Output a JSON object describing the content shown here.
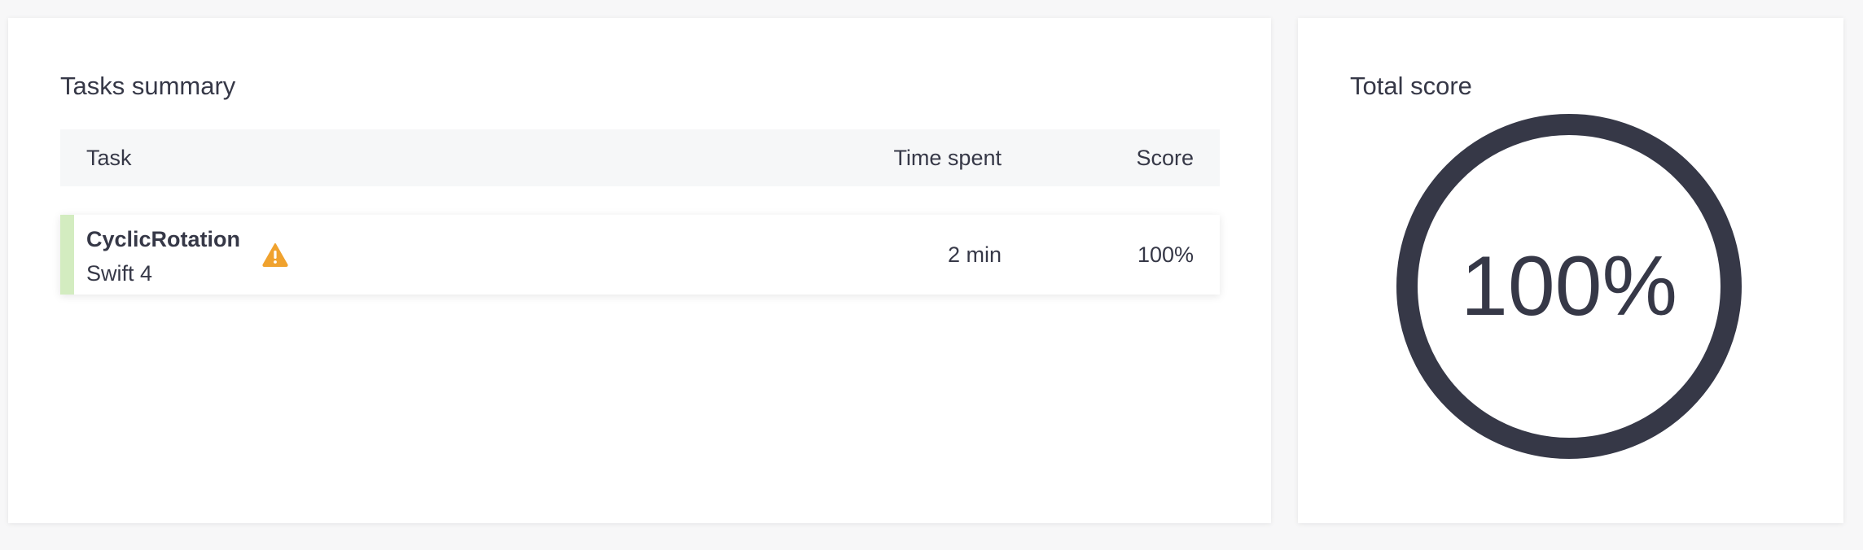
{
  "tasks_summary": {
    "title": "Tasks summary",
    "columns": {
      "task": "Task",
      "time_spent": "Time spent",
      "score": "Score"
    },
    "rows": [
      {
        "name": "CyclicRotation",
        "language": "Swift 4",
        "time_spent": "2 min",
        "score": "100%",
        "icon": "warning-icon",
        "accent_color": "#d3ecc0"
      }
    ]
  },
  "total_score": {
    "title": "Total score",
    "value": "100%",
    "fraction": 1.0,
    "ring_color": "#363847"
  },
  "colors": {
    "warning": "#f0a22e",
    "text": "#363847",
    "header_bg": "#f6f7f8"
  }
}
